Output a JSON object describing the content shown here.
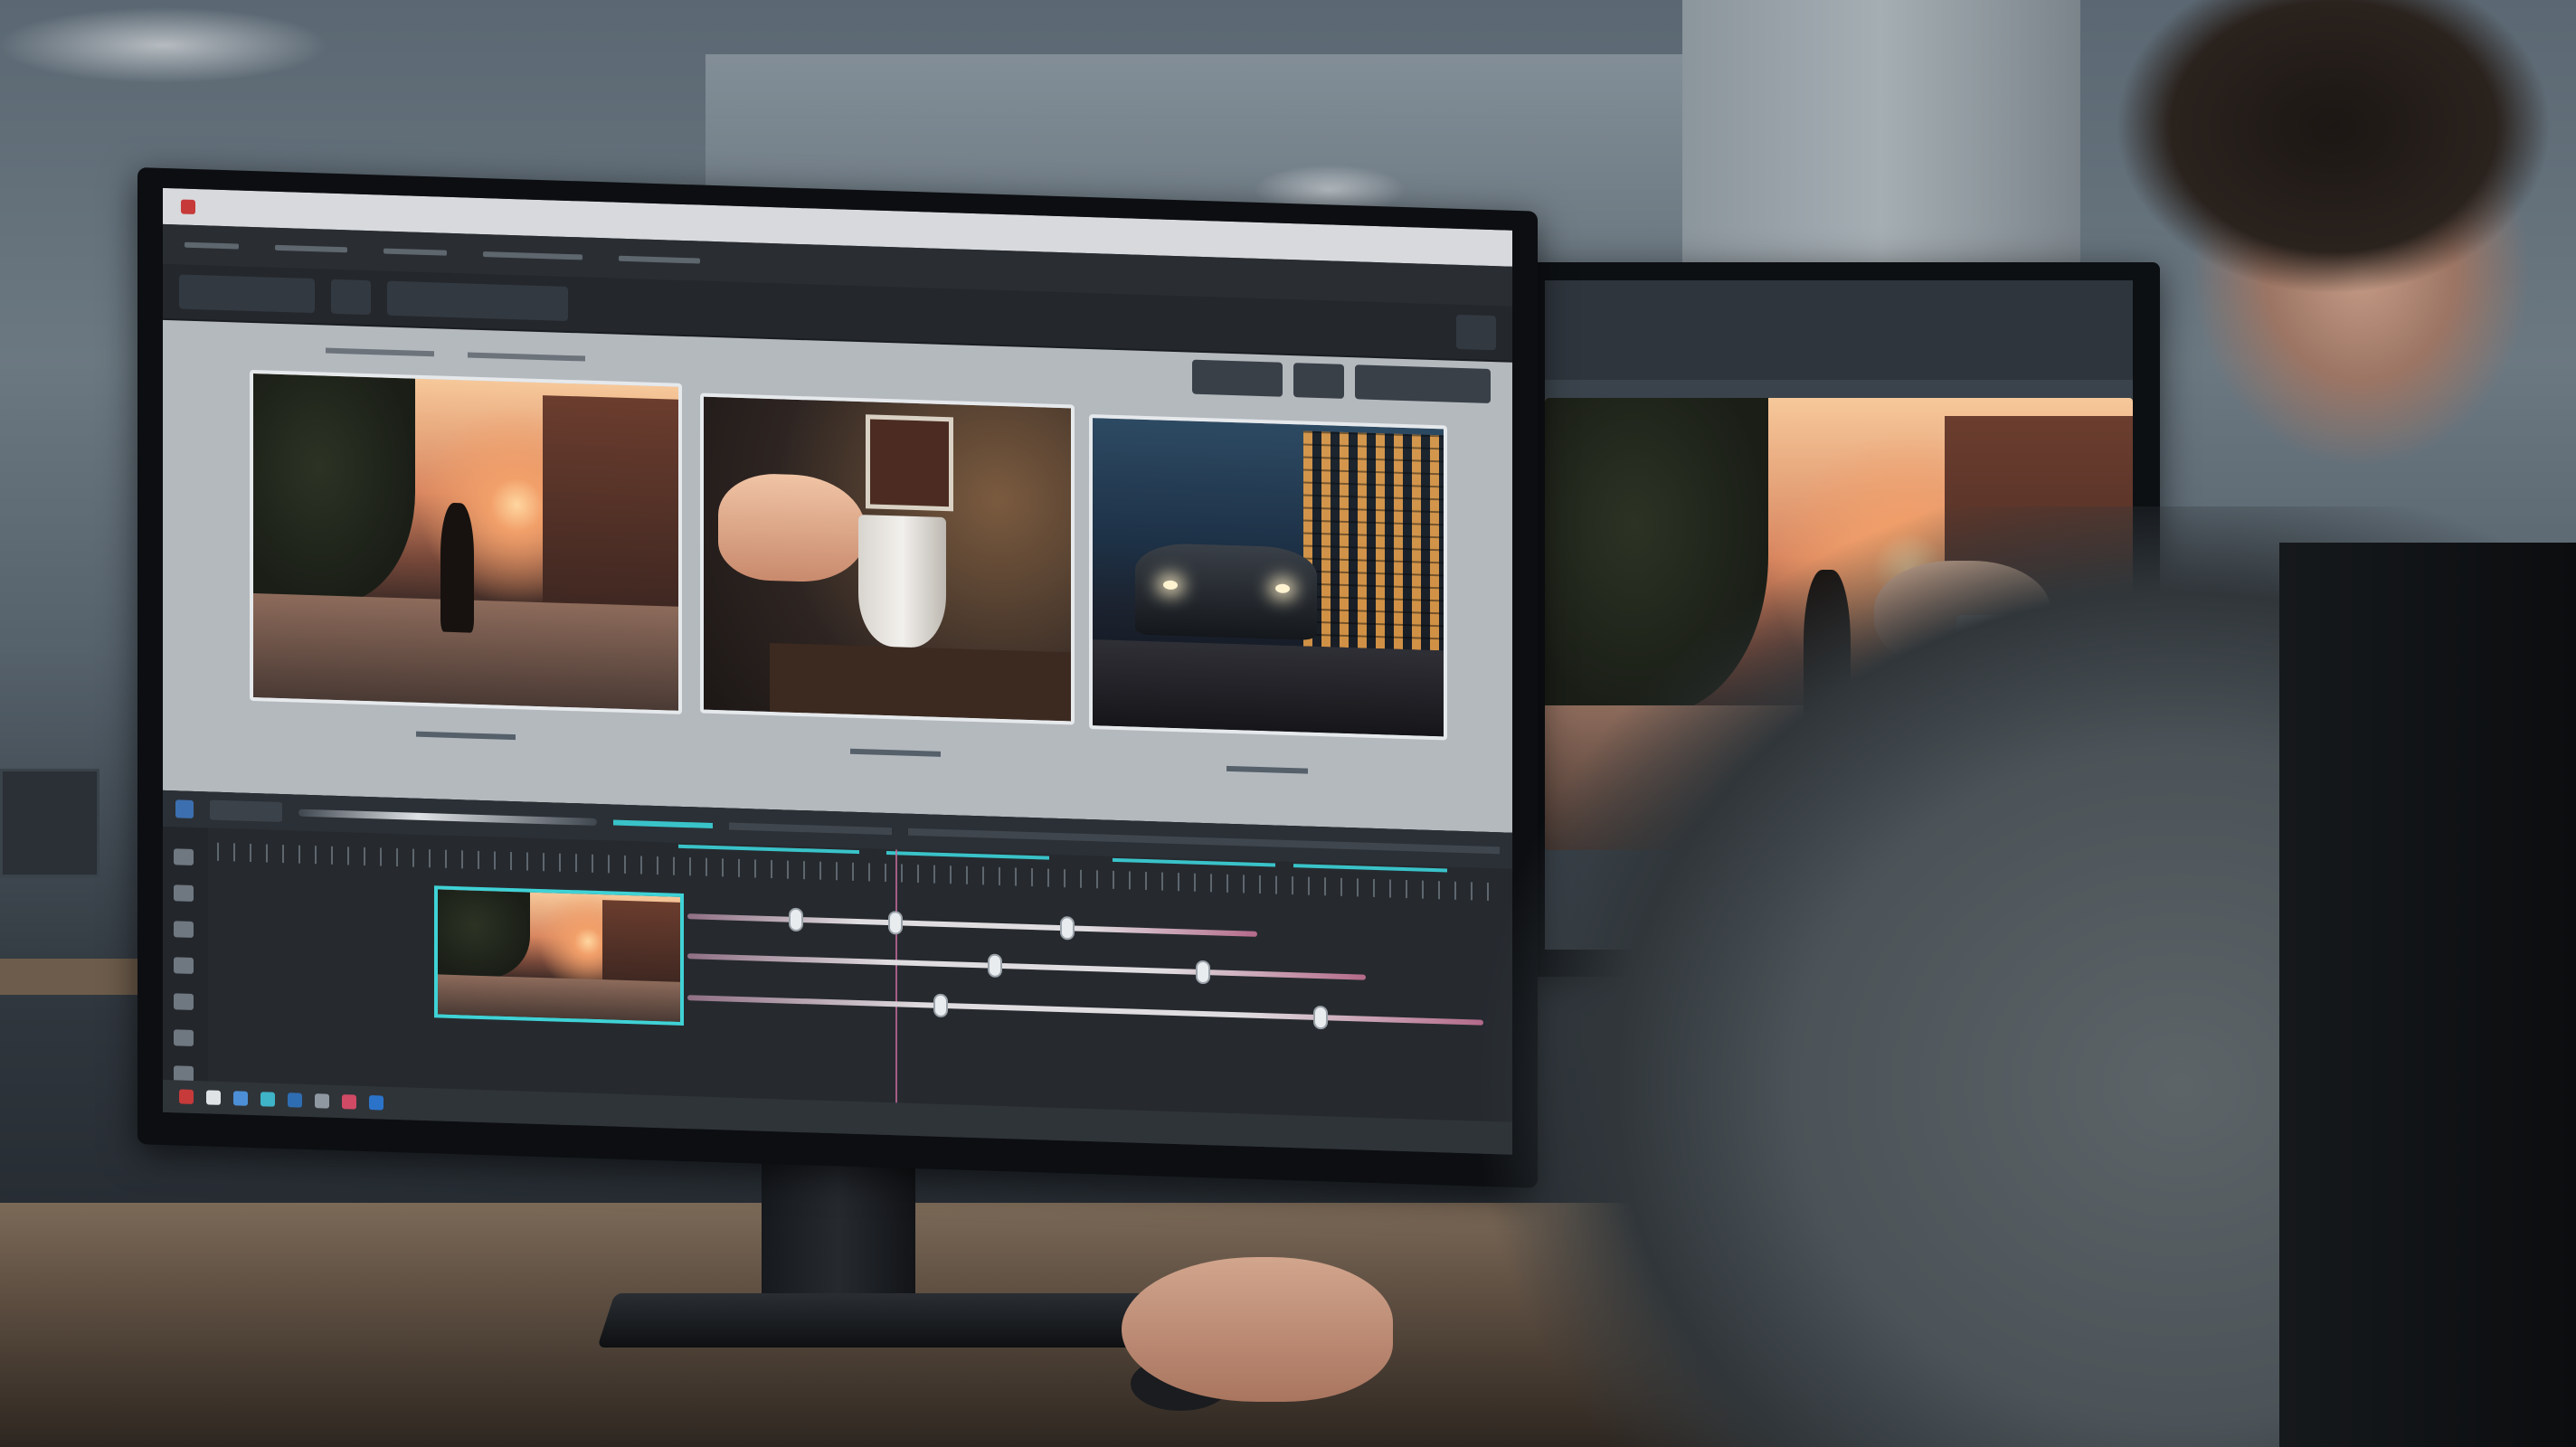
{
  "main_window": {
    "title": "",
    "menu": [],
    "toolbar": [],
    "viewer_tools": []
  },
  "clips": [
    {
      "top_label": "",
      "bottom_label": ""
    },
    {
      "top_label": "",
      "bottom_label": ""
    },
    {
      "top_label": "",
      "bottom_label": ""
    }
  ],
  "timeline": {
    "timecode": ""
  },
  "colors": {
    "accent": "#39c3c9",
    "playhead": "#c56a9b",
    "editor_bg": "#2b2f35",
    "viewer_bg": "#b4b9be"
  }
}
